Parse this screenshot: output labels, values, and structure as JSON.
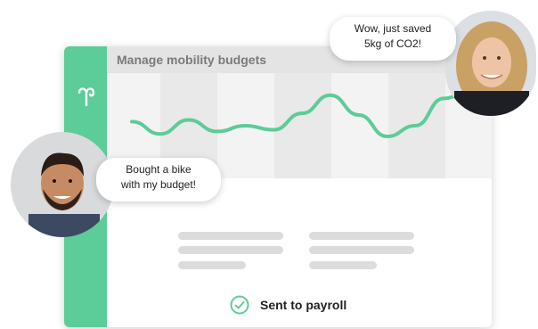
{
  "header": {
    "title": "Manage mobility budgets"
  },
  "logo": {
    "icon": "sidebar-logo-icon"
  },
  "chart_data": {
    "type": "line",
    "x": [
      1,
      2,
      3,
      4,
      5,
      6,
      7,
      8,
      9,
      10,
      11,
      12,
      13
    ],
    "series": [
      {
        "values": [
          60,
          45,
          62,
          48,
          55,
          50,
          70,
          92,
          68,
          42,
          55,
          88,
          100
        ]
      }
    ],
    "ylim": [
      0,
      110
    ],
    "grid": false
  },
  "status": {
    "label": "Sent to payroll",
    "icon": "check-circle-icon"
  },
  "bubbles": {
    "right": {
      "line1": "Wow, just saved",
      "line2": "5kg of CO2!"
    },
    "left": {
      "line1": "Bought a bike",
      "line2": "with my budget!"
    }
  },
  "colors": {
    "accent": "#5ccc98",
    "header_bg": "#e4e4e4",
    "skeleton": "#dcdcdc"
  }
}
